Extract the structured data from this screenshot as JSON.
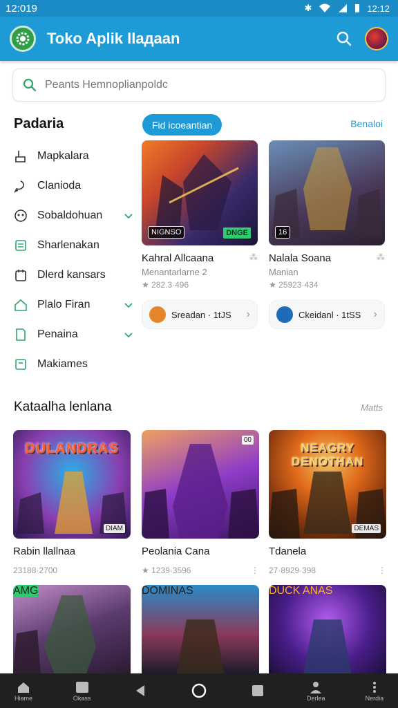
{
  "status_bar": {
    "time": "12:019",
    "battery_time": "12:12"
  },
  "app_bar": {
    "title": "Toko Aplik llaдaan",
    "logo_icon": "gear-logo-icon",
    "search_icon": "search-icon"
  },
  "search": {
    "placeholder": "Peants Hemnoplianpoldc"
  },
  "sidebar": {
    "title": "Padaria",
    "items": [
      {
        "label": "Mapkalara",
        "icon": "hand-icon",
        "chevron": false
      },
      {
        "label": "Clanioda",
        "icon": "chat-icon",
        "chevron": false
      },
      {
        "label": "Sobaldohuan",
        "icon": "gamepad-icon",
        "chevron": true
      },
      {
        "label": "Sharlenakan",
        "icon": "list-icon",
        "chevron": false
      },
      {
        "label": "Dlerd kansars",
        "icon": "calendar-icon",
        "chevron": false
      },
      {
        "label": "Plalo Firan",
        "icon": "home-icon",
        "chevron": true
      },
      {
        "label": "Penaina",
        "icon": "doc-icon",
        "chevron": true
      },
      {
        "label": "Makiames",
        "icon": "box-icon",
        "chevron": false
      }
    ]
  },
  "featured": {
    "chip_label": "Fid icoeantian",
    "link_label": "Benaloi",
    "cards": [
      {
        "title": "Kahral Allcaana",
        "subtitle": "Menantarlarne 2",
        "rating": "★ 282.3·496",
        "badge": "NIGNSO",
        "badge2": "DNGE",
        "colors": [
          "#f07b2a",
          "#3a2b6b",
          "#1b1436"
        ]
      },
      {
        "title": "Nalala Soana",
        "subtitle": "Manian",
        "rating": "★ 25923·434",
        "badge": "16",
        "badge2": "",
        "colors": [
          "#6a8fb8",
          "#4b3a5a",
          "#2a1f2f"
        ]
      }
    ],
    "mini_buttons": [
      {
        "label": "Sreadan · 1tJS",
        "icon_color": "#e5862b"
      },
      {
        "label": "Ckeidanl · 1tSS",
        "icon_color": "#1e6cb8"
      }
    ]
  },
  "section": {
    "title": "Kataalha lenlana",
    "link": "Matts",
    "games": [
      {
        "name": "Rabin llallnaa",
        "meta": "23188·2700",
        "title_art": "DULANDRAS",
        "tag": "DIAM",
        "colors": [
          "#2ab0e8",
          "#8a3fb0",
          "#2a1850"
        ]
      },
      {
        "name": "Peolania Cana",
        "meta": "★ 1239·3596",
        "title_art": "",
        "tag": "00",
        "colors": [
          "#f0a060",
          "#8e3cc8",
          "#3a1660"
        ]
      },
      {
        "name": "Tdanela",
        "meta": "27·8929·398",
        "title_art": "NEAGRY DENOTHAN",
        "tag": "DEMAS",
        "colors": [
          "#e06a1a",
          "#8a3a10",
          "#2a1208"
        ]
      }
    ],
    "games_row2": [
      {
        "title_art": "",
        "tag": "AMG",
        "colors": [
          "#c28ec9",
          "#5a3b6e",
          "#2a1a2f"
        ]
      },
      {
        "title_art": "DOMINAS",
        "tag": "",
        "colors": [
          "#2a8bc8",
          "#8a3a5a",
          "#1a1a2a"
        ]
      },
      {
        "title_art": "DUCK ANAS",
        "tag": "",
        "colors": [
          "#b35cf0",
          "#4a1e8a",
          "#1a0f3a"
        ]
      }
    ]
  },
  "nav_bar": {
    "items": [
      {
        "label": "Hiame",
        "icon": "home-icon"
      },
      {
        "label": "Okass",
        "icon": "inbox-icon"
      },
      {
        "label": "",
        "icon": "back-icon"
      },
      {
        "label": "",
        "icon": "home-circle-icon"
      },
      {
        "label": "",
        "icon": "recents-icon"
      },
      {
        "label": "Derlea",
        "icon": "person-icon"
      },
      {
        "label": "Nerdia",
        "icon": "more-icon"
      }
    ]
  }
}
